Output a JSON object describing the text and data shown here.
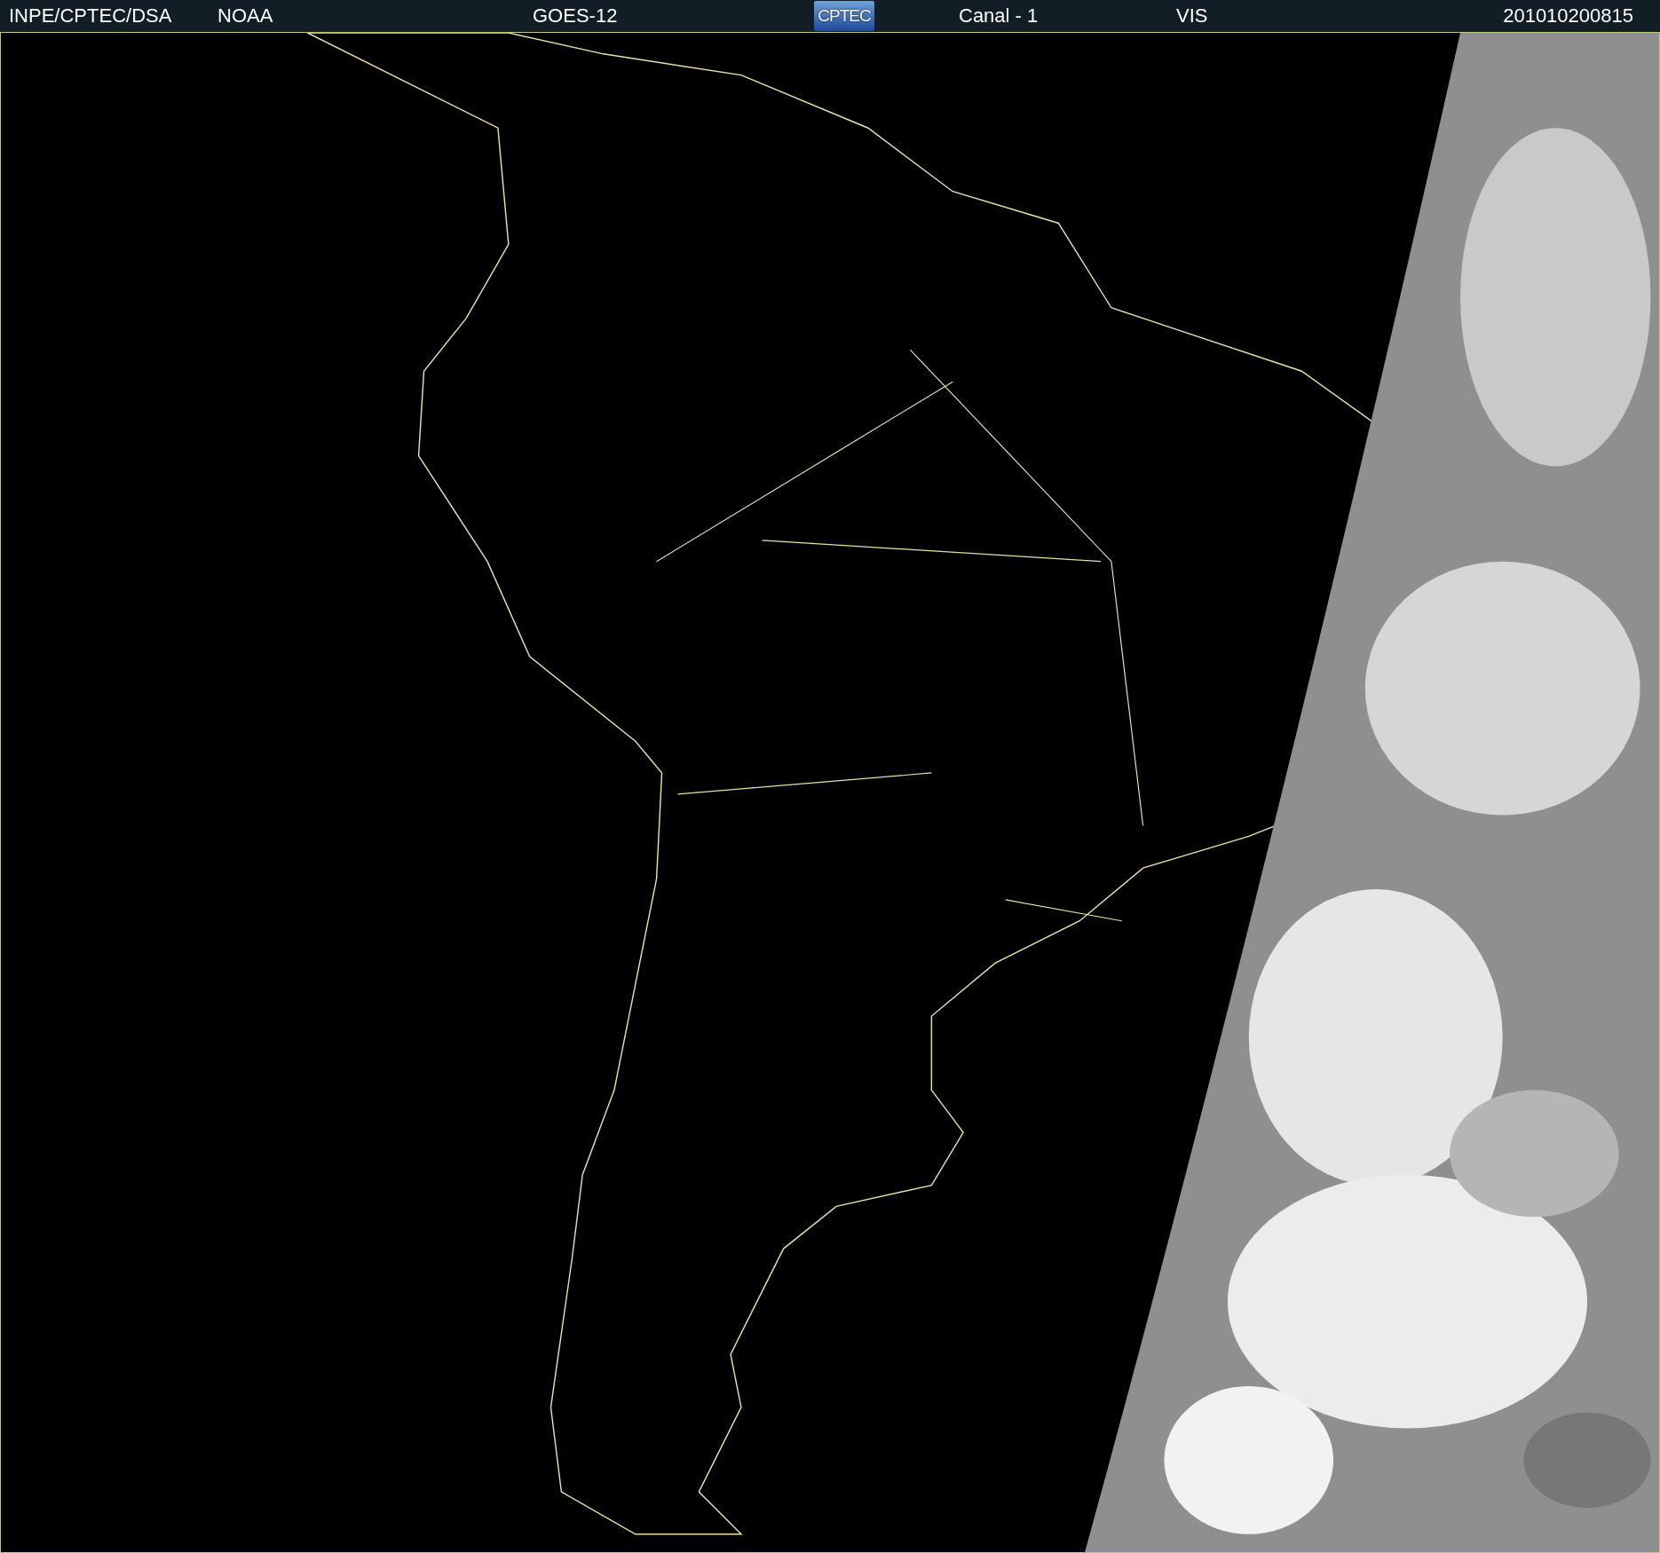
{
  "header": {
    "items": [
      {
        "kind": "text",
        "text": "INPE/CPTEC/DSA"
      },
      {
        "kind": "text",
        "text": "NOAA"
      },
      {
        "kind": "text",
        "text": "GOES-12"
      },
      {
        "kind": "logo",
        "text": "CPTEC"
      },
      {
        "kind": "text",
        "text": "Canal - 1"
      },
      {
        "kind": "text",
        "text": "VIS"
      },
      {
        "kind": "text",
        "text": "201010200815"
      }
    ]
  }
}
